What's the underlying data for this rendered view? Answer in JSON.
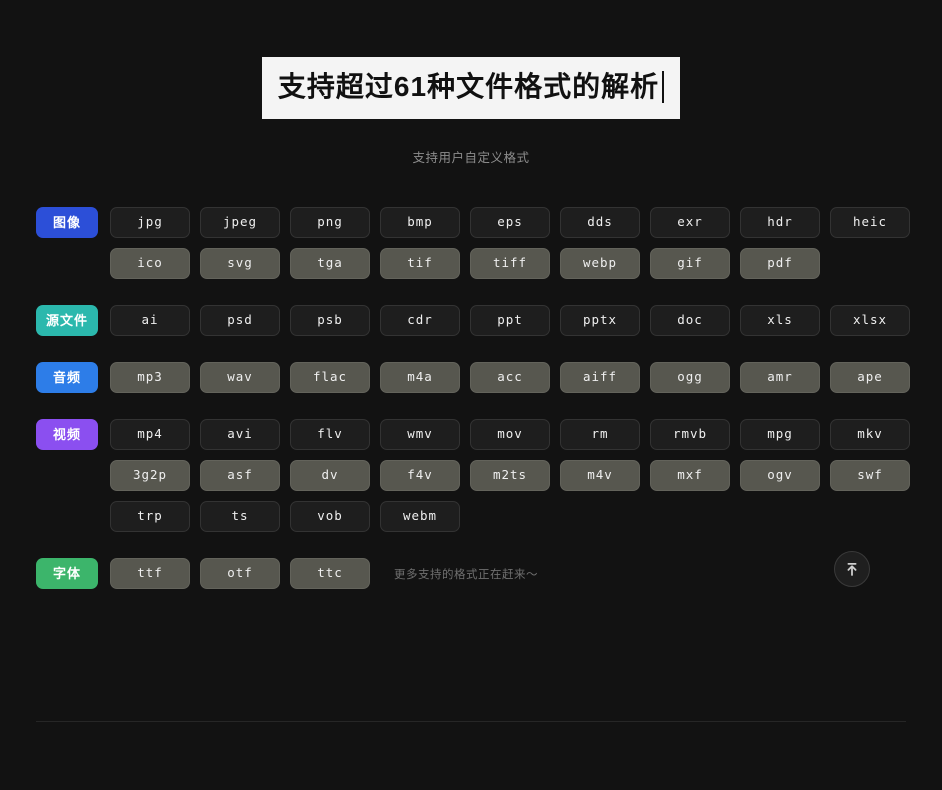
{
  "header": {
    "title": "支持超过61种文件格式的解析",
    "subtitle": "支持用户自定义格式"
  },
  "groups": [
    {
      "badge": "图像",
      "badge_color": "#2c4fd8",
      "rows": [
        {
          "style": "dark",
          "chips": [
            "jpg",
            "jpeg",
            "png",
            "bmp",
            "eps",
            "dds",
            "exr",
            "hdr",
            "heic"
          ]
        },
        {
          "style": "light",
          "chips": [
            "ico",
            "svg",
            "tga",
            "tif",
            "tiff",
            "webp",
            "gif",
            "pdf"
          ]
        }
      ]
    },
    {
      "badge": "源文件",
      "badge_color": "#2bb8ad",
      "rows": [
        {
          "style": "dark",
          "chips": [
            "ai",
            "psd",
            "psb",
            "cdr",
            "ppt",
            "pptx",
            "doc",
            "xls",
            "xlsx"
          ]
        }
      ]
    },
    {
      "badge": "音频",
      "badge_color": "#2d7de8",
      "rows": [
        {
          "style": "light",
          "chips": [
            "mp3",
            "wav",
            "flac",
            "m4a",
            "acc",
            "aiff",
            "ogg",
            "amr",
            "ape"
          ]
        }
      ]
    },
    {
      "badge": "视频",
      "badge_color": "#8b4ff0",
      "rows": [
        {
          "style": "dark",
          "chips": [
            "mp4",
            "avi",
            "flv",
            "wmv",
            "mov",
            "rm",
            "rmvb",
            "mpg",
            "mkv"
          ]
        },
        {
          "style": "light",
          "chips": [
            "3g2p",
            "asf",
            "dv",
            "f4v",
            "m2ts",
            "m4v",
            "mxf",
            "ogv",
            "swf"
          ]
        },
        {
          "style": "dark",
          "chips": [
            "trp",
            "ts",
            "vob",
            "webm"
          ]
        }
      ]
    },
    {
      "badge": "字体",
      "badge_color": "#3cb56b",
      "rows": [
        {
          "style": "light",
          "chips": [
            "ttf",
            "otf",
            "ttc"
          ],
          "note": "更多支持的格式正在赶来～"
        }
      ]
    }
  ],
  "fab": {
    "icon": "scroll-to-top-icon"
  }
}
